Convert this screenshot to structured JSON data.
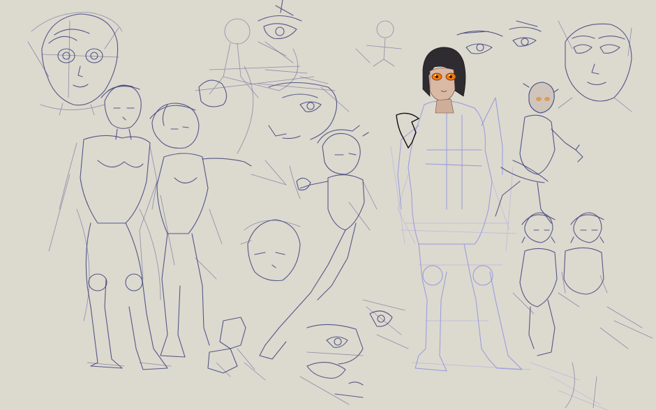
{
  "scene": {
    "background": "#dcd9cf",
    "ink_dark": "#3d3f7a",
    "ink_light": "#8a8ee0",
    "hair_color": "#2e2c30",
    "eye_color": "#f07a10",
    "skin_color": "#d9b9a4"
  }
}
